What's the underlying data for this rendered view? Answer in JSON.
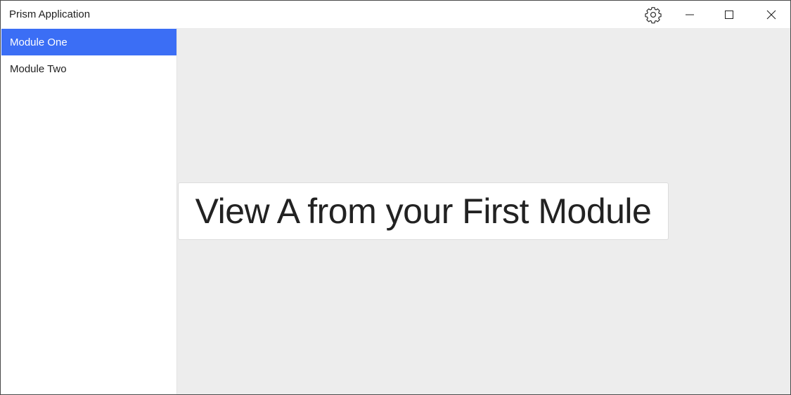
{
  "window": {
    "title": "Prism Application"
  },
  "titlebar": {
    "settings_icon": "gear-icon",
    "minimize_icon": "minimize-icon",
    "maximize_icon": "maximize-icon",
    "close_icon": "close-icon"
  },
  "sidebar": {
    "items": [
      {
        "label": "Module One",
        "selected": true
      },
      {
        "label": "Module Two",
        "selected": false
      }
    ],
    "selected_color": "#3b6ef5"
  },
  "main": {
    "view_text": "View A from your First Module",
    "background_color": "#ededed"
  }
}
